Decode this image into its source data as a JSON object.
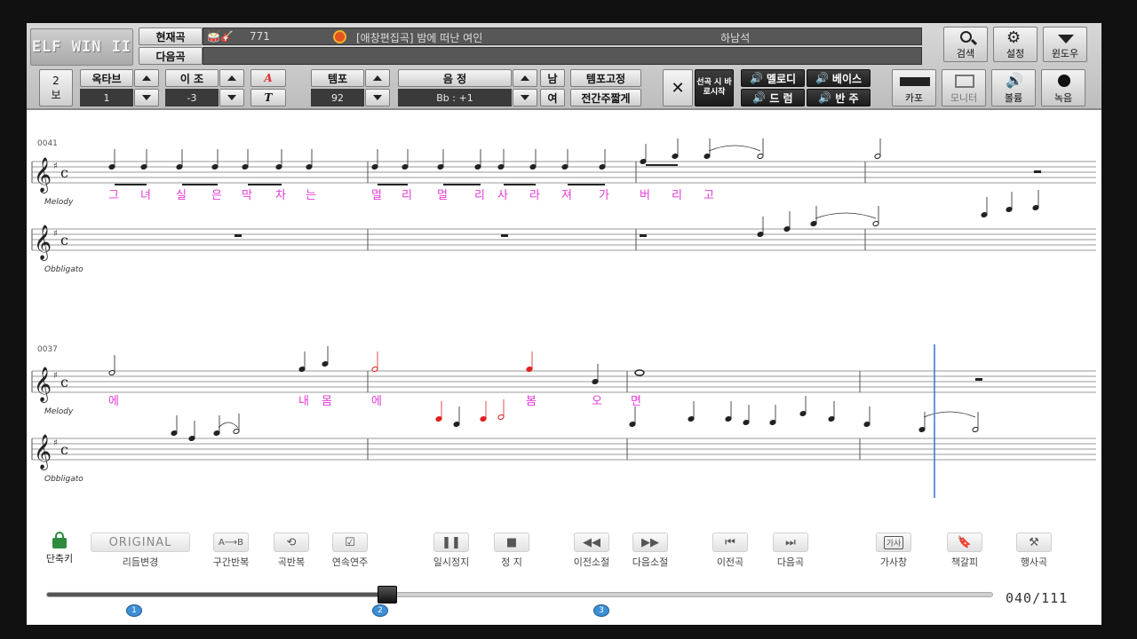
{
  "logo": "ELF WIN II",
  "current_song": {
    "label": "현재곡",
    "number": "771",
    "title": "[애창편집곡] 밤에 떠난 여인",
    "singer": "하남석"
  },
  "next_song": {
    "label": "다음곡"
  },
  "top_right": {
    "search": "검색",
    "settings": "설정",
    "window": "윈도우"
  },
  "controls": {
    "page_num": "2",
    "page_label": "보",
    "octave_label": "옥타브",
    "octave_value": "1",
    "transpose_label": "이 조",
    "transpose_value": "-3",
    "tempo_label": "템포",
    "tempo_value": "92",
    "key_label": "음 정",
    "key_value": "Bb : +1",
    "male": "남",
    "female": "여",
    "tempo_fix": "템포고정",
    "short_intro": "전간주짧게",
    "start_on_select": "선곡 시 바로시작",
    "melody": "멜로디",
    "bass": "베이스",
    "drum": "드 럼",
    "accomp": "반 주",
    "capo": "카포",
    "monitor": "모니터",
    "volume": "볼륨",
    "record": "녹음"
  },
  "score": {
    "system1": {
      "measure": "0041",
      "parts": [
        "Melody",
        "Obbligato"
      ]
    },
    "system2": {
      "measure": "0037",
      "parts": [
        "Melody",
        "Obbligato"
      ]
    },
    "lyrics1": [
      "그",
      "녀",
      "실",
      "은",
      "막",
      "차",
      "는",
      "멀",
      "리",
      "멀",
      "리",
      "사",
      "라",
      "져",
      "가",
      "버",
      "리",
      "고"
    ],
    "lyrics2": [
      "에",
      "내",
      "몸",
      "에",
      "봄",
      "오",
      "면"
    ]
  },
  "bottom": {
    "lock": "단축키",
    "original": "ORIGINAL",
    "rhythm": "리듬변경",
    "section_repeat": "구간반복",
    "song_repeat": "곡반복",
    "continuous": "연속연주",
    "pause": "일시정지",
    "stop": "정 지",
    "prev_measure": "이전소절",
    "next_measure": "다음소절",
    "prev_song": "이전곡",
    "next_song": "다음곡",
    "lyrics_btn_icon": "가사",
    "lyrics_window": "가사창",
    "bookmark": "책갈피",
    "event_song": "행사곡"
  },
  "progress": {
    "fraction": 0.36,
    "counter": "040/111",
    "markers": [
      "1",
      "2",
      "3"
    ]
  },
  "colors": {
    "lyric": "#e23ad6",
    "highlight_note": "#e02020",
    "cursor": "#3a6fd8"
  }
}
